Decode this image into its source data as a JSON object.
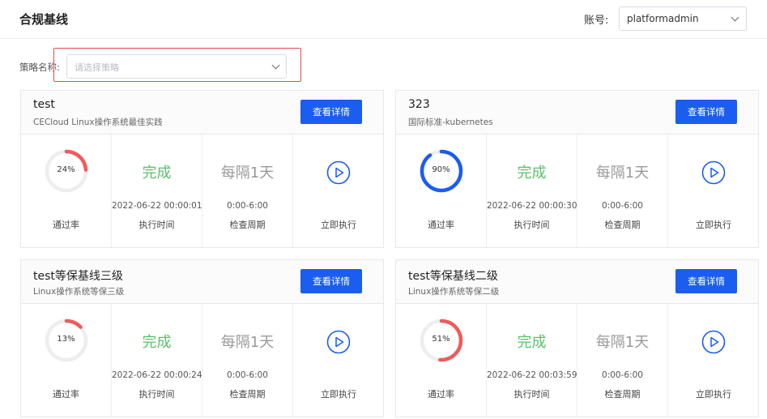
{
  "header": {
    "title": "合规基线",
    "account_label": "账号:",
    "account_value": "platformadmin"
  },
  "filter": {
    "label": "策略名称:",
    "placeholder": "请选择策略"
  },
  "labels": {
    "detail": "查看详情",
    "pass_rate": "通过率",
    "exec_time": "执行时间",
    "check_cycle": "检查周期",
    "run_now": "立即执行"
  },
  "colors": {
    "accent": "#1a5df0",
    "success": "#5cbf6d",
    "danger": "#ef5b5b",
    "ring_bg": "#eeeeee",
    "highlight": "#e84b4b"
  },
  "cards": [
    {
      "name": "test",
      "desc": "CECloud Linux操作系统最佳实践",
      "pass_rate": 0.24,
      "pass_rate_text": "24%",
      "ring_color": "#ef5b5b",
      "status": "完成",
      "exec_time": "2022-06-22 00:00:01",
      "frequency": "每隔1天",
      "cycle": "0:00-6:00"
    },
    {
      "name": "323",
      "desc": "国际标准-kubernetes",
      "pass_rate": 0.9,
      "pass_rate_text": "90%",
      "ring_color": "#1a5df0",
      "status": "完成",
      "exec_time": "2022-06-22 00:00:30",
      "frequency": "每隔1天",
      "cycle": "0:00-6:00"
    },
    {
      "name": "test等保基线三级",
      "desc": "Linux操作系统等保三级",
      "pass_rate": 0.13,
      "pass_rate_text": "13%",
      "ring_color": "#ef5b5b",
      "status": "完成",
      "exec_time": "2022-06-22 00:00:24",
      "frequency": "每隔1天",
      "cycle": "0:00-6:00"
    },
    {
      "name": "test等保基线二级",
      "desc": "Linux操作系统等保二级",
      "pass_rate": 0.51,
      "pass_rate_text": "51%",
      "ring_color": "#ef5b5b",
      "status": "完成",
      "exec_time": "2022-06-22 00:03:59",
      "frequency": "每隔1天",
      "cycle": "0:00-6:00"
    }
  ]
}
